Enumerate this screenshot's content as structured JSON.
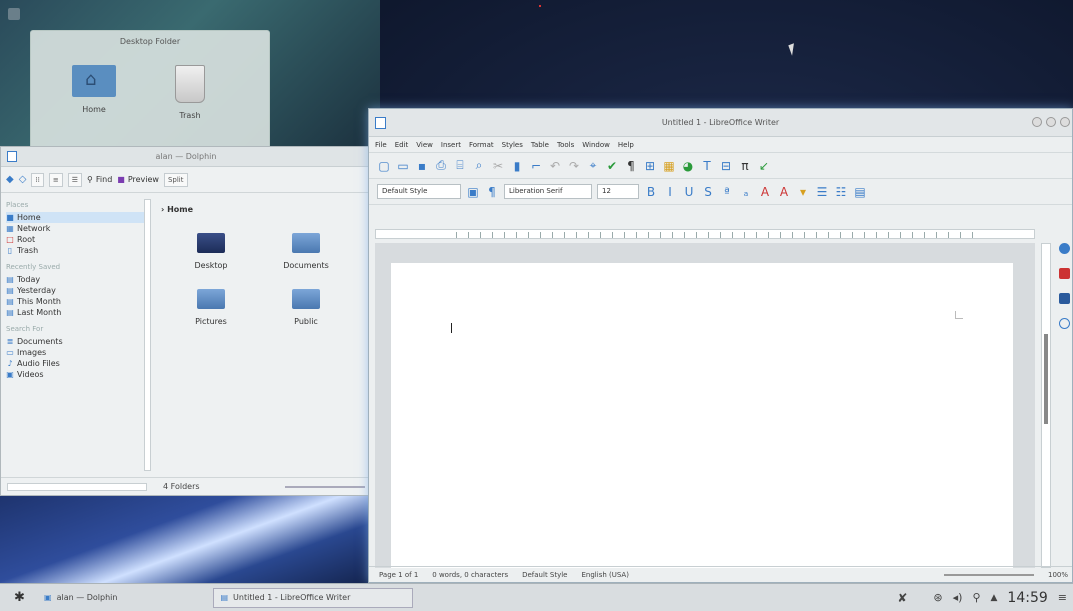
{
  "desktop_folder": {
    "title": "Desktop Folder",
    "items": [
      {
        "label": "Home"
      },
      {
        "label": "Trash"
      }
    ]
  },
  "dolphin": {
    "title": "alan — Dolphin",
    "toolbar": {
      "find": "Find",
      "preview": "Preview",
      "split": "Split"
    },
    "places": {
      "header": "Places",
      "items": [
        {
          "label": "Home",
          "icon": "home-icon"
        },
        {
          "label": "Network",
          "icon": "network-icon"
        },
        {
          "label": "Root",
          "icon": "root-folder-icon"
        },
        {
          "label": "Trash",
          "icon": "trash-icon"
        }
      ],
      "recent_header": "Recently Saved",
      "recent": [
        {
          "label": "Today"
        },
        {
          "label": "Yesterday"
        },
        {
          "label": "This Month"
        },
        {
          "label": "Last Month"
        }
      ],
      "search_header": "Search For",
      "search": [
        {
          "label": "Documents"
        },
        {
          "label": "Images"
        },
        {
          "label": "Audio Files"
        },
        {
          "label": "Videos"
        }
      ]
    },
    "breadcrumb": "Home",
    "files": [
      {
        "label": "Desktop"
      },
      {
        "label": "Documents"
      },
      {
        "label": "Pictures"
      },
      {
        "label": "Public"
      }
    ],
    "status": "4 Folders"
  },
  "writer": {
    "title": "Untitled 1 - LibreOffice Writer",
    "menu": [
      "File",
      "Edit",
      "View",
      "Insert",
      "Format",
      "Styles",
      "Table",
      "Tools",
      "Window",
      "Help"
    ],
    "style": "Default Style",
    "font": "Liberation Serif",
    "size": "12",
    "status": {
      "page": "Page 1 of 1",
      "words": "0 words, 0 characters",
      "style": "Default Style",
      "lang": "English (USA)",
      "zoom": "100%"
    }
  },
  "taskbar": {
    "tasks": [
      {
        "label": "alan — Dolphin"
      },
      {
        "label": "Untitled 1 - LibreOffice Writer"
      }
    ],
    "clock": "14:59"
  }
}
